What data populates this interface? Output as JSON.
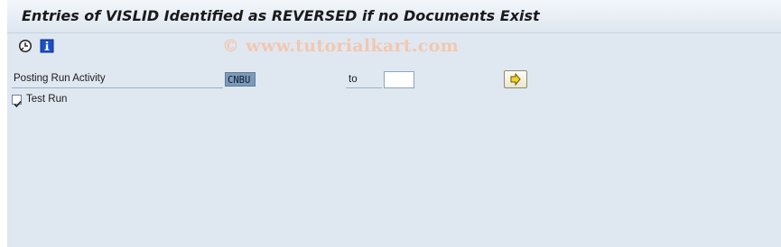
{
  "title": "Entries of VISLID Identified as REVERSED if no Documents Exist",
  "toolbar": {
    "execute_icon": "execute-clock-icon",
    "info_icon": "info-icon"
  },
  "watermark": "© www.tutorialkart.com",
  "selection": {
    "posting_run_activity_label": "Posting Run Activity",
    "posting_run_activity_low": "CNBU",
    "to_label": "to",
    "posting_run_activity_high": "",
    "multiple_selection_icon": "arrow-right-icon",
    "test_run_label": "Test Run",
    "test_run_checked": true
  },
  "colors": {
    "background": "#dfe8f1",
    "field_highlight": "#7f99b7"
  }
}
